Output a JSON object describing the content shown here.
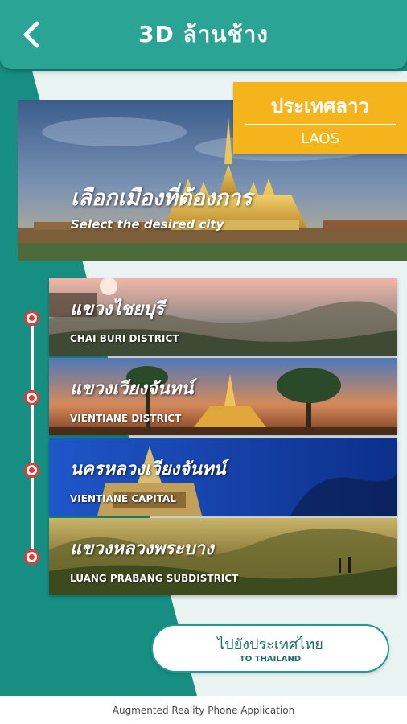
{
  "header": {
    "title": "3D ล้านช้าง",
    "back_icon": "back-arrow-icon"
  },
  "hero": {
    "title_th": "เลือกเมืองที่ต้องการ",
    "title_en": "Select the desired city"
  },
  "country": {
    "name_th": "ประเทศลาว",
    "name_en": "LAOS"
  },
  "districts": [
    {
      "name_th": "แขวงไชยบุรี",
      "name_en": "CHAI BURI DISTRICT"
    },
    {
      "name_th": "แขวงเวียงจันทน์",
      "name_en": "VIENTIANE DISTRICT"
    },
    {
      "name_th": "นครหลวงเวียงจันทน์",
      "name_en": "VIENTIANE CAPITAL"
    },
    {
      "name_th": "แขวงหลวงพระบาง",
      "name_en": "LUANG PRABANG SUBDISTRICT"
    }
  ],
  "thailand_button": {
    "label_th": "ไปยังประเทศไทย",
    "label_en": "TO THAILAND"
  },
  "footer": {
    "text": "Augmented Reality Phone Application"
  },
  "colors": {
    "header": "#2aa595",
    "background_teal": "#178e82",
    "badge": "#f6b41c",
    "timeline_dot": "#e53935"
  }
}
